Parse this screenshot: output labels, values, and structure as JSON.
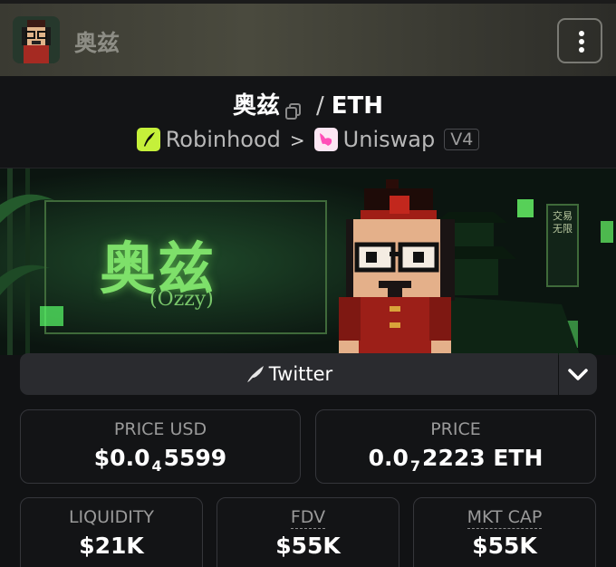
{
  "header": {
    "title": "奥兹"
  },
  "pair": {
    "base": "奥兹",
    "separator": "/",
    "quote": "ETH",
    "chain": "Robinhood",
    "dex": "Uniswap",
    "version": "V4"
  },
  "banner": {
    "title": "奥兹",
    "subtitle": "(Ozzy)",
    "sign_text": "交易无限"
  },
  "twitter": {
    "label": "Twitter"
  },
  "stats": {
    "price_usd": {
      "label": "PRICE USD",
      "prefix": "$0.0",
      "zeros": "4",
      "suffix": "5599"
    },
    "price": {
      "label": "PRICE",
      "prefix": "0.0",
      "zeros": "7",
      "suffix": "2223 ETH"
    },
    "liquidity": {
      "label": "LIQUIDITY",
      "value": "$21K"
    },
    "fdv": {
      "label": "FDV",
      "value": "$55K"
    },
    "mkt_cap": {
      "label": "MKT CAP",
      "value": "$55K"
    }
  },
  "colors": {
    "accent_green": "#7ee06a",
    "robinhood": "#c5f03a",
    "uniswap": "#ff4fb8"
  }
}
